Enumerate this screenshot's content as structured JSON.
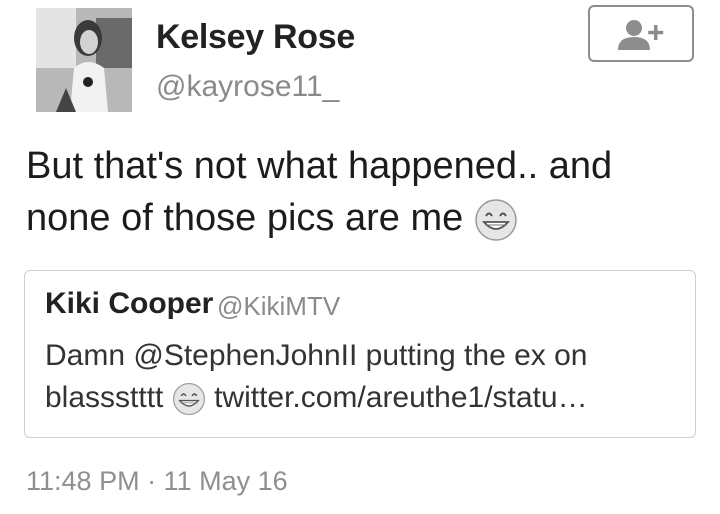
{
  "author": {
    "display_name": "Kelsey Rose",
    "handle": "@kayrose11_",
    "avatar_icon": "profile-photo"
  },
  "follow_button": {
    "icon": "add-user-icon"
  },
  "tweet": {
    "text_part1": "But that's not what happened.. and none of those pics are me",
    "emoji": "grinning-face"
  },
  "quoted_tweet": {
    "author_name": "Kiki Cooper",
    "author_handle": "@KikiMTV",
    "text_part1": "Damn @StephenJohnII putting the ex on blassstttt",
    "emoji": "grinning-face",
    "link_text": "twitter.com/areuthe1/statu…"
  },
  "timestamp": "11:48 PM · 11 May 16",
  "colors": {
    "text": "#1c1c1c",
    "muted": "#8a8a8a",
    "border": "#cfcfcf"
  }
}
